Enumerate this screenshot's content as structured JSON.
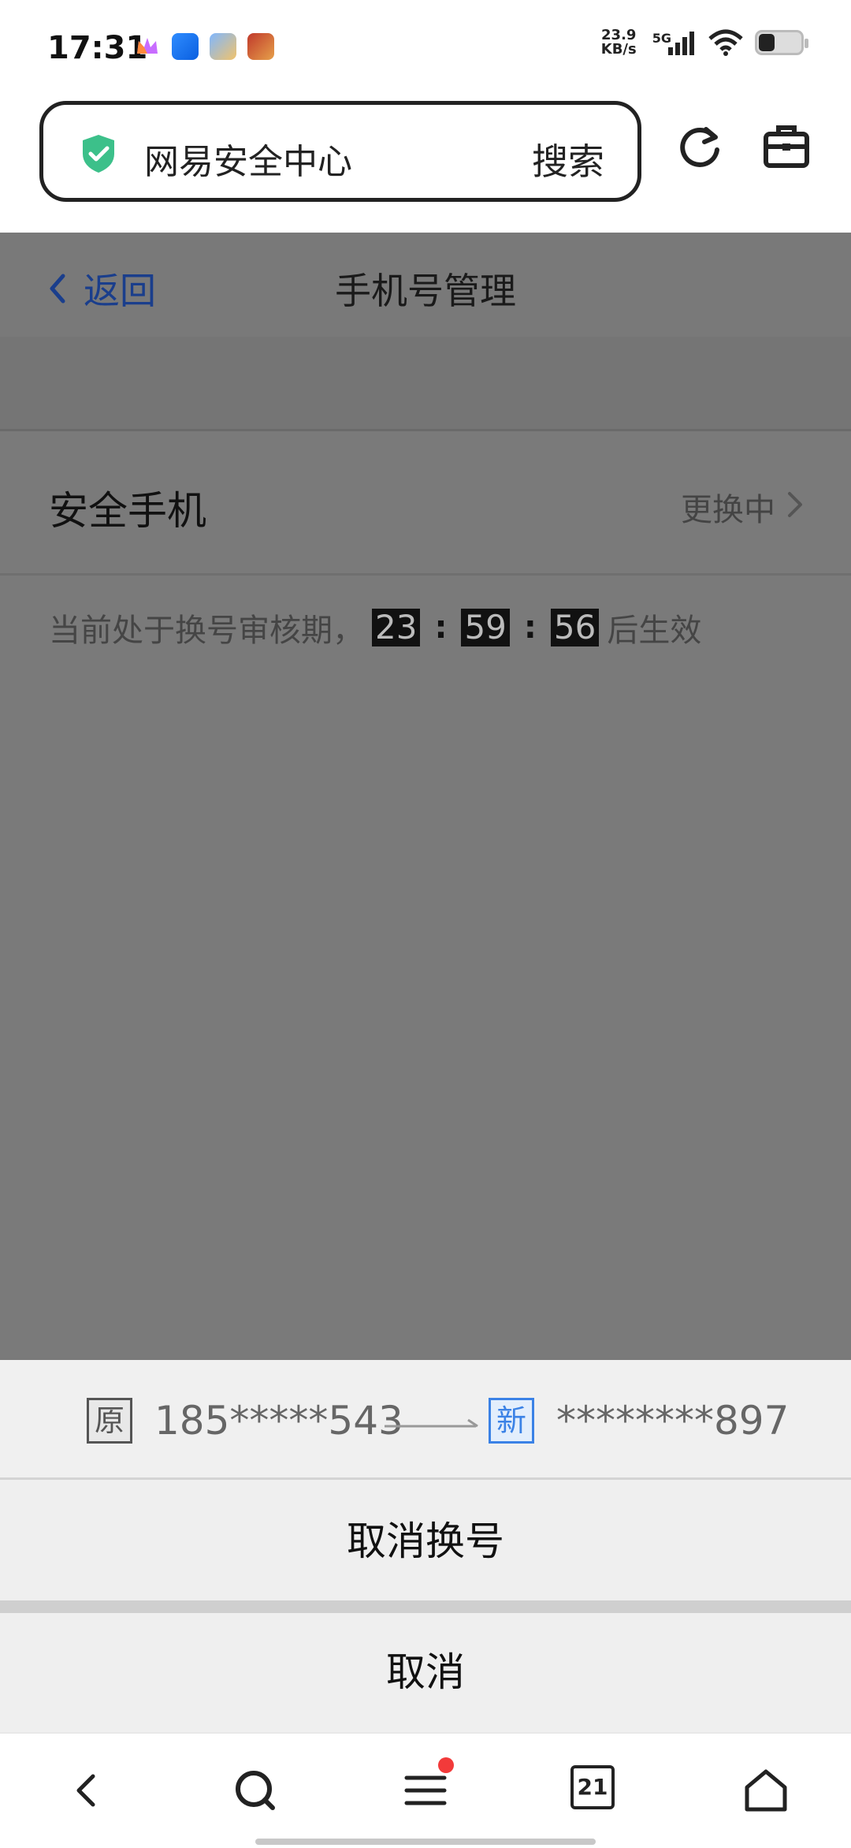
{
  "status_bar": {
    "time": "17:31",
    "net_speed_value": "23.9",
    "net_speed_unit": "KB/s",
    "network_type": "5G"
  },
  "browser": {
    "url_title": "网易安全中心",
    "search_label": "搜索"
  },
  "page": {
    "back_label": "返回",
    "title": "手机号管理",
    "security_phone_label": "安全手机",
    "security_phone_status": "更换中",
    "notice_prefix": "当前处于换号审核期，",
    "countdown": {
      "hours": "23",
      "minutes": "59",
      "seconds": "56"
    },
    "notice_suffix": "后生效"
  },
  "sheet": {
    "old_tag": "原",
    "old_number": "185*****543",
    "new_tag": "新",
    "new_number": "********897",
    "cancel_change_label": "取消换号",
    "cancel_label": "取消"
  },
  "bottom_nav": {
    "tabs_count": "21"
  },
  "colors": {
    "overlay": "#7a7a7a",
    "link_blue": "#1a3e8c",
    "new_tag_blue": "#3b82e6",
    "shield_green": "#3cc08a",
    "badge_red": "#f23a3a"
  },
  "icons": [
    "crown-icon",
    "planet-icon",
    "cloud-icon",
    "game-icon",
    "signal-icon",
    "wifi-icon",
    "battery-icon",
    "shield-check-icon",
    "refresh-icon",
    "toolbox-icon",
    "chevron-left-icon",
    "chevron-right-icon",
    "arrow-right-icon",
    "back-icon",
    "search-icon",
    "menu-icon",
    "tabs-icon",
    "home-icon"
  ]
}
